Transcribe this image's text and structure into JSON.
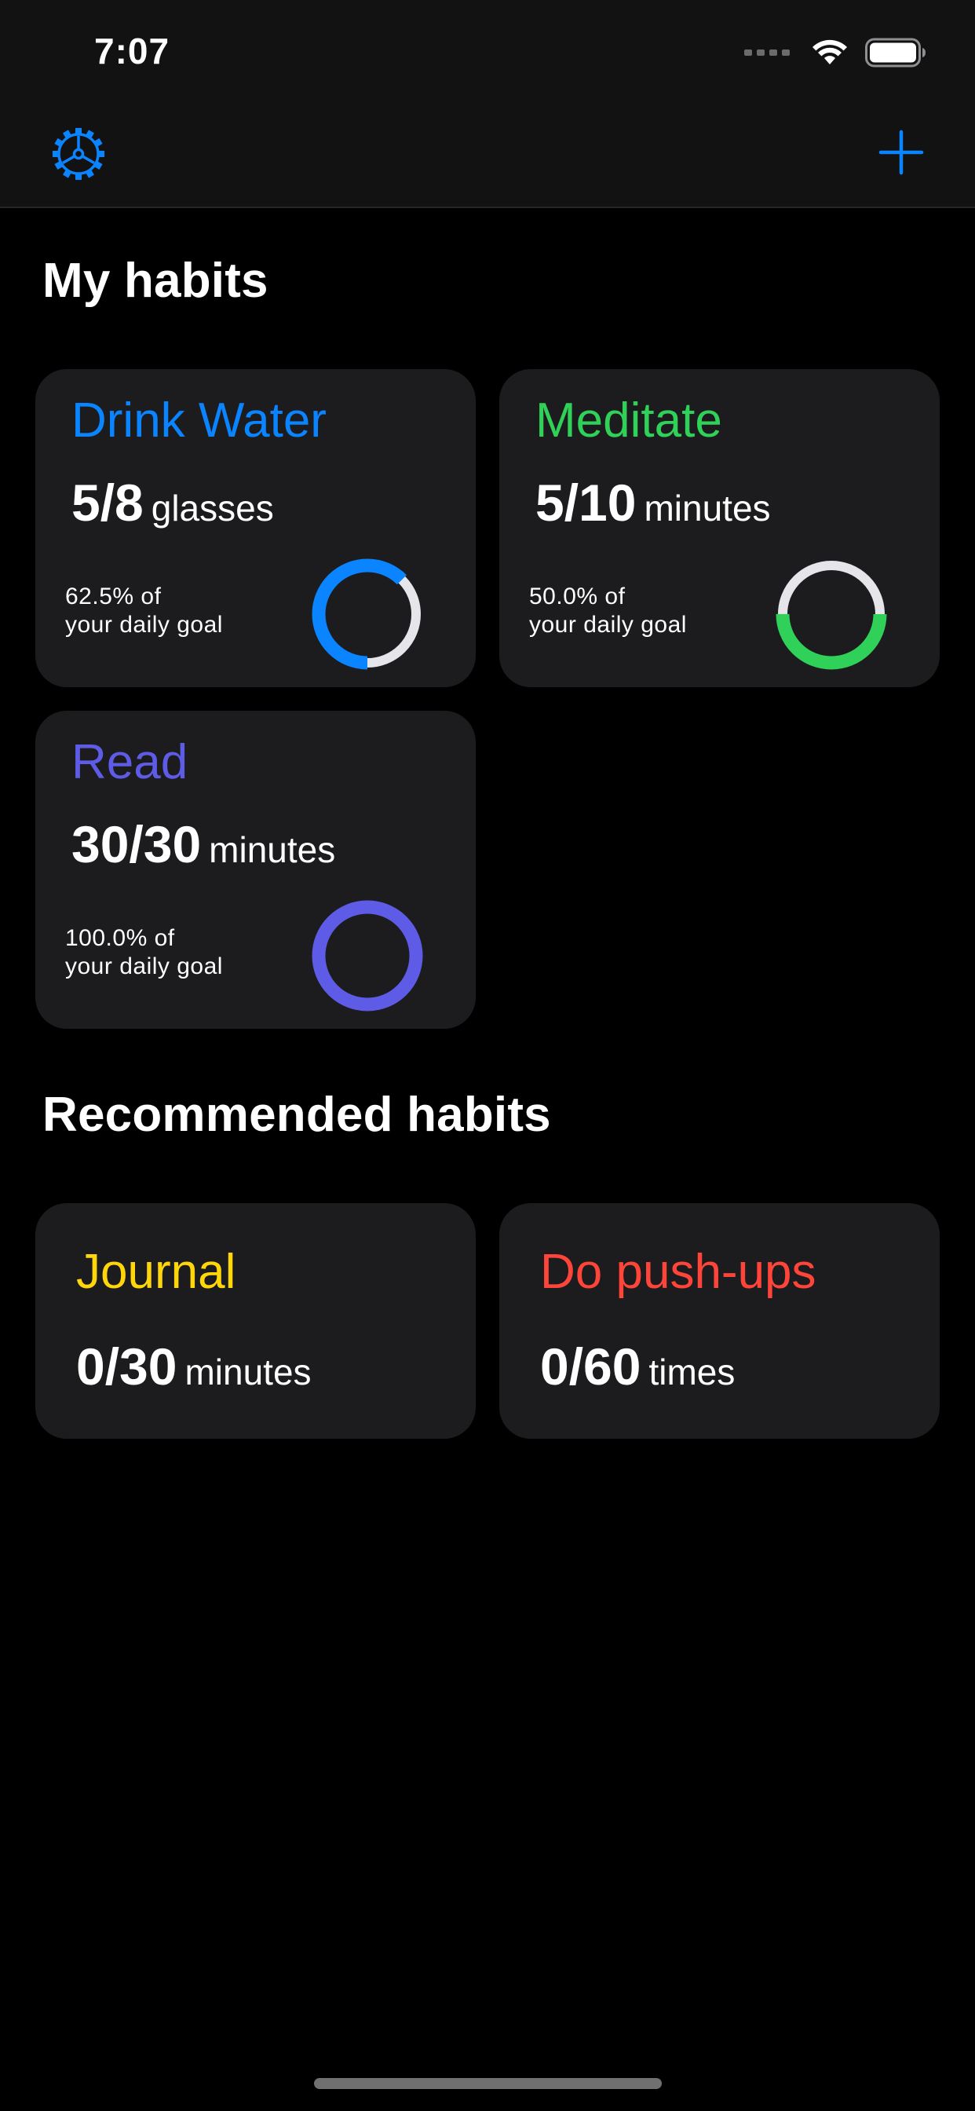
{
  "status_bar": {
    "time": "7:07"
  },
  "colors": {
    "accent": "#0a84ff",
    "blue": "#0a84ff",
    "green": "#30d158",
    "indigo": "#5e5ce6",
    "yellow": "#ffd60a",
    "red": "#ff453a",
    "ring_track": "#e5e5ea"
  },
  "nav": {
    "settings_icon": "gear-icon",
    "add_icon": "plus-icon"
  },
  "my_habits": {
    "title": "My habits",
    "items": [
      {
        "name": "Drink Water",
        "count": "5/8",
        "unit": "glasses",
        "goal_line1": "62.5% of",
        "goal_line2": "your daily goal",
        "progress": 0.625,
        "color": "#0a84ff"
      },
      {
        "name": "Meditate",
        "count": "5/10",
        "unit": "minutes",
        "goal_line1": "50.0% of",
        "goal_line2": "your daily goal",
        "progress": 0.5,
        "color": "#30d158"
      },
      {
        "name": "Read",
        "count": "30/30",
        "unit": "minutes",
        "goal_line1": "100.0% of",
        "goal_line2": "your daily goal",
        "progress": 1.0,
        "color": "#5e5ce6"
      }
    ]
  },
  "recommended_habits": {
    "title": "Recommended habits",
    "items": [
      {
        "name": "Journal",
        "count": "0/30",
        "unit": "minutes",
        "color": "#ffd60a"
      },
      {
        "name": "Do push-ups",
        "count": "0/60",
        "unit": "times",
        "color": "#ff453a"
      }
    ]
  }
}
